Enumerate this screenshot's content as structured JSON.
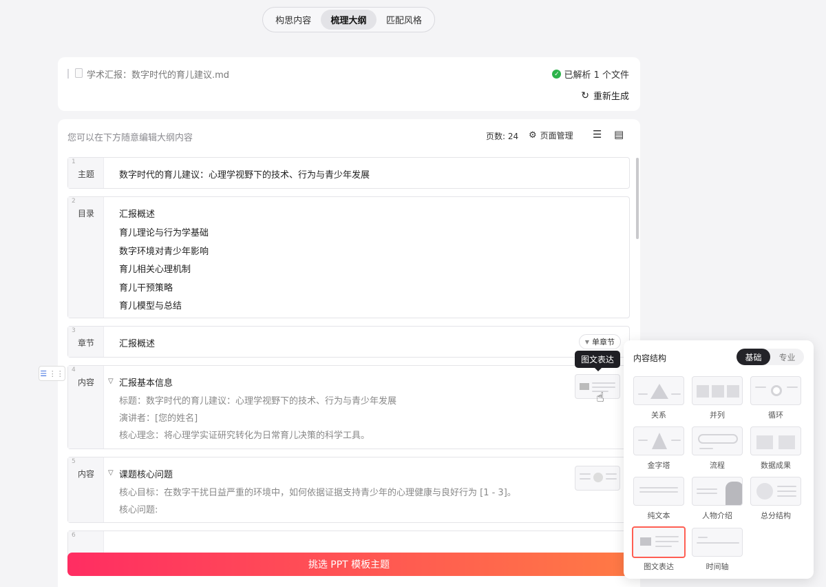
{
  "tabs": [
    "构思内容",
    "梳理大纲",
    "匹配风格"
  ],
  "file": {
    "name": "学术汇报：数字时代的育儿建议.md",
    "parsed": "已解析 1 个文件",
    "regenerate": "重新生成"
  },
  "outline": {
    "hint": "您可以在下方随意编辑大纲内容",
    "pages": "页数: 24",
    "page_manage": "页面管理"
  },
  "rows": [
    {
      "num": "1",
      "tag": "主题",
      "title": "数字时代的育儿建议：心理学视野下的技术、行为与青少年发展"
    },
    {
      "num": "2",
      "tag": "目录",
      "items": [
        "汇报概述",
        "育儿理论与行为学基础",
        "数字环境对青少年影响",
        "育儿相关心理机制",
        "育儿干预策略",
        "育儿模型与总结"
      ]
    },
    {
      "num": "3",
      "tag": "章节",
      "title": "汇报概述",
      "chip": "单章节"
    },
    {
      "num": "4",
      "tag": "内容",
      "title": "汇报基本信息",
      "details": [
        "标题：数字时代的育儿建议：心理学视野下的技术、行为与青少年发展",
        "演讲者：[您的姓名]",
        "核心理念：将心理学实证研究转化为日常育儿决策的科学工具。"
      ]
    },
    {
      "num": "5",
      "tag": "内容",
      "title": "课题核心问题",
      "details": [
        "核心目标：在数字干扰日益严重的环境中，如何依据证据支持青少年的心理健康与良好行为 [1 - 3]。",
        "核心问题:"
      ]
    },
    {
      "num": "6"
    }
  ],
  "tooltip": "图文表达",
  "cta": "挑选 PPT 模板主题",
  "panel": {
    "title": "内容结构",
    "seg": [
      "基础",
      "专业"
    ],
    "cards": [
      "关系",
      "并列",
      "循环",
      "金字塔",
      "流程",
      "数据成果",
      "纯文本",
      "人物介绍",
      "总分结构",
      "图文表达",
      "时间轴"
    ]
  },
  "colors": {
    "accent_start": "#ff2d62",
    "accent_end": "#ff7a45",
    "check": "#2cb34a",
    "selected_border": "#ff5e52"
  }
}
